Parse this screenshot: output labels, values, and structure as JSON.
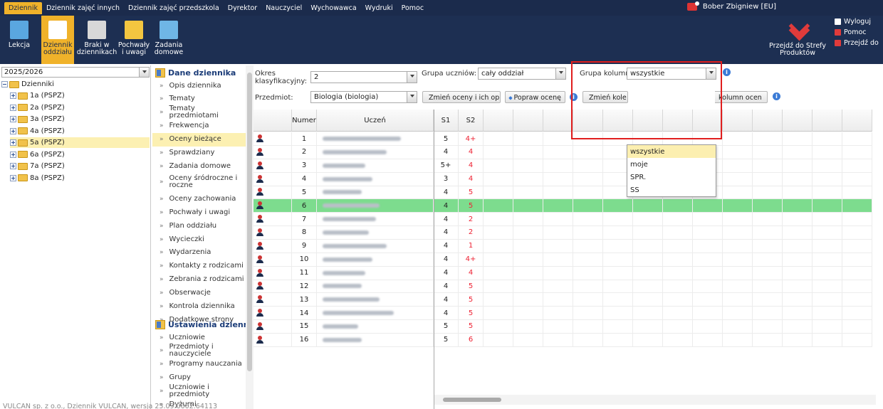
{
  "menu": [
    "Dziennik",
    "Dziennik zajęć innych",
    "Dziennik zajęć przedszkola",
    "Dyrektor",
    "Nauczyciel",
    "Wychowawca",
    "Wydruki",
    "Pomoc"
  ],
  "user": "Bober Zbigniew [EU]",
  "toolbar": [
    {
      "label1": "Lekcja",
      "label2": "",
      "icon": "lesson-icon",
      "color": "#5aa7e0"
    },
    {
      "label1": "Dziennik",
      "label2": "oddziału",
      "icon": "class-register-icon",
      "color": "#ffffff"
    },
    {
      "label1": "Braki w",
      "label2": "dziennikach",
      "icon": "missing-entries-icon",
      "color": "#d8d8d8"
    },
    {
      "label1": "Pochwały",
      "label2": "i uwagi",
      "icon": "praise-remarks-icon",
      "color": "#f3c640"
    },
    {
      "label1": "Zadania",
      "label2": "domowe",
      "icon": "homework-icon",
      "color": "#6fb6e6"
    }
  ],
  "strefa": {
    "line1": "Przejdź do Strefy",
    "line2": "Produktów",
    "icon": "vulcan-chevron-icon"
  },
  "links": [
    {
      "label": "Wyloguj",
      "icon": "logout-icon",
      "color": "#ffffff"
    },
    {
      "label": "Pomoc",
      "icon": "help-icon",
      "color": "#e03b3b"
    },
    {
      "label": "Przejdź do",
      "icon": "home-icon",
      "color": "#e03b3b"
    }
  ],
  "tree": {
    "year": "2025/2026",
    "root": "Dzienniki",
    "classes": [
      "1a (PSPZ)",
      "2a (PSPZ)",
      "3a (PSPZ)",
      "4a (PSPZ)",
      "5a (PSPZ)",
      "6a (PSPZ)",
      "7a (PSPZ)",
      "8a (PSPZ)"
    ],
    "selected_index": 4
  },
  "nav": {
    "section1": "Dane dziennika",
    "items1": [
      "Opis dziennika",
      "Tematy",
      "Tematy przedmiotami",
      "Frekwencja",
      "Oceny bieżące",
      "Sprawdziany",
      "Zadania domowe",
      "Oceny śródroczne i roczne",
      "Oceny zachowania",
      "Pochwały i uwagi",
      "Plan oddziału",
      "Wycieczki",
      "Wydarzenia",
      "Kontakty z rodzicami",
      "Zebrania z rodzicami",
      "Obserwacje",
      "Kontrola dziennika",
      "Dodatkowe strony"
    ],
    "selected": "Oceny bieżące",
    "section2": "Ustawienia dziennika",
    "items2": [
      "Uczniowie",
      "Przedmioty i nauczyciele",
      "Programy nauczania",
      "Grupy",
      "Uczniowie i przedmioty",
      "Dyżurni"
    ]
  },
  "filters": {
    "period_label_1": "Okres",
    "period_label_2": "klasyfikacyjny:",
    "period_value": "2",
    "group_label": "Grupa uczniów:",
    "group_value": "cały oddział",
    "col_group_label": "Grupa kolumn:",
    "col_group_value": "wszystkie",
    "subject_label": "Przedmiot:",
    "subject_value": "Biologia (biologia)"
  },
  "buttons": {
    "change_grades": "Zmień oceny i ich opis",
    "fix_grade": "Popraw ocenę",
    "change_order": "Zmień kole",
    "columns": "kolumn ocen"
  },
  "dropdown": {
    "options": [
      "wszystkie",
      "moje",
      "SPR.",
      "SS"
    ],
    "active_index": 0
  },
  "table": {
    "headers": {
      "number": "Numer",
      "student": "Uczeń",
      "s1": "S1",
      "s2": "S2"
    },
    "rows": [
      {
        "num": "1",
        "s1": "5",
        "s2": "4+"
      },
      {
        "num": "2",
        "s1": "4",
        "s2": "4"
      },
      {
        "num": "3",
        "s1": "5+",
        "s2": "4"
      },
      {
        "num": "4",
        "s1": "3",
        "s2": "4"
      },
      {
        "num": "5",
        "s1": "4",
        "s2": "5"
      },
      {
        "num": "6",
        "s1": "4",
        "s2": "5"
      },
      {
        "num": "7",
        "s1": "4",
        "s2": "2"
      },
      {
        "num": "8",
        "s1": "4",
        "s2": "2"
      },
      {
        "num": "9",
        "s1": "4",
        "s2": "1"
      },
      {
        "num": "10",
        "s1": "4",
        "s2": "4+"
      },
      {
        "num": "11",
        "s1": "4",
        "s2": "4"
      },
      {
        "num": "12",
        "s1": "4",
        "s2": "5"
      },
      {
        "num": "13",
        "s1": "4",
        "s2": "5"
      },
      {
        "num": "14",
        "s1": "4",
        "s2": "5"
      },
      {
        "num": "15",
        "s1": "5",
        "s2": "5"
      },
      {
        "num": "16",
        "s1": "5",
        "s2": "6"
      }
    ],
    "highlight_index": 5
  },
  "footer": "VULCAN sp. z o.o., Dziennik VULCAN, wersja 25.09.0002.64113",
  "colors": {
    "accent": "#f0b22a",
    "topbar": "#1b2b4c",
    "selection": "#fcf0b2",
    "row_highlight": "#7ddc8e",
    "highlight_box": "#e01e1e"
  }
}
